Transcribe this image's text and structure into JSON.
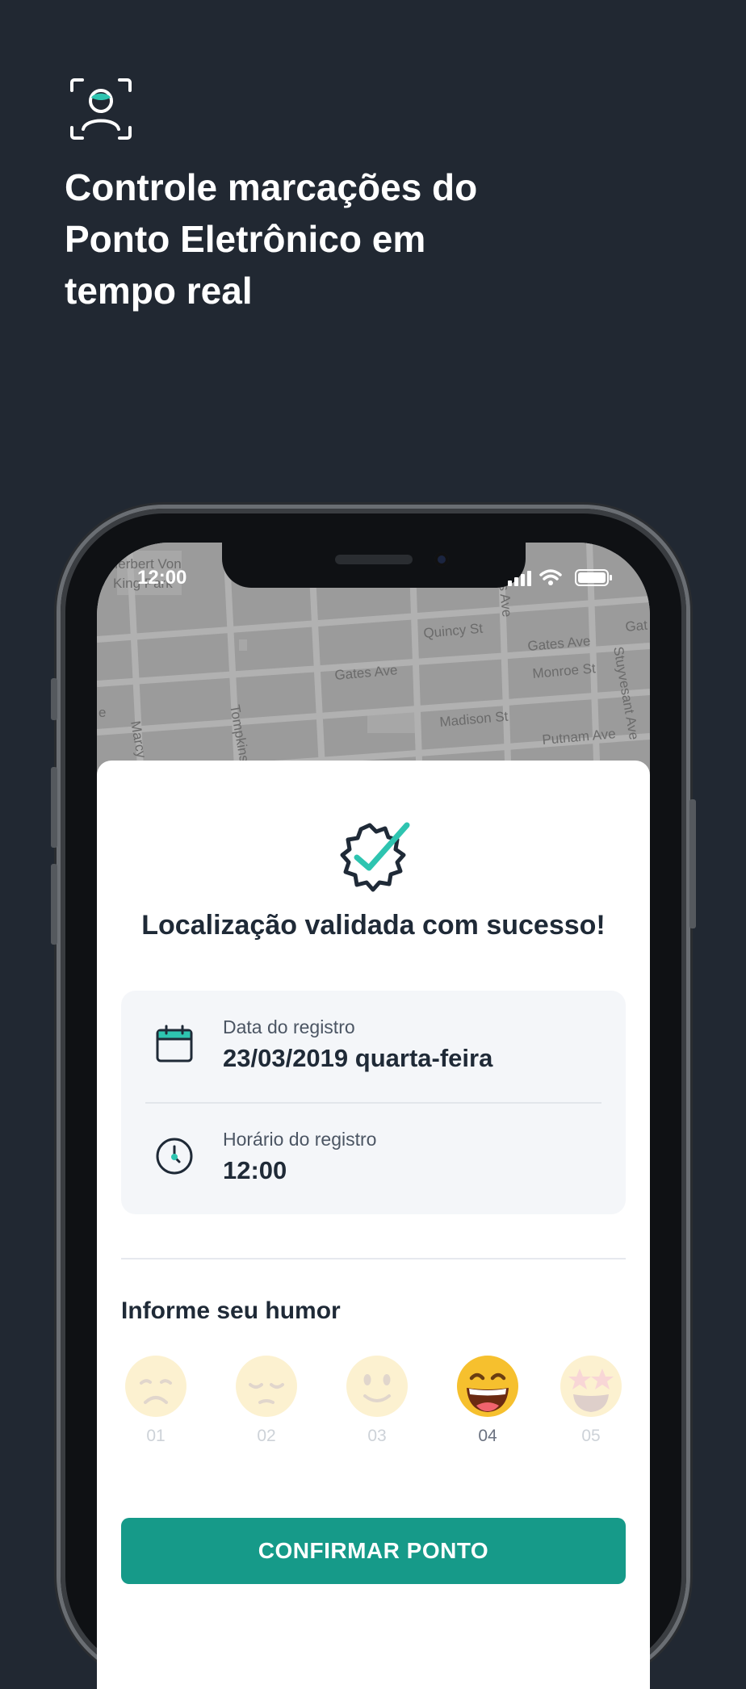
{
  "hero": {
    "icon": "face-scan-icon",
    "headline_lines": [
      "Controle marcações do",
      "Ponto Eletrônico em",
      "tempo real"
    ]
  },
  "status_bar": {
    "time": "12:00"
  },
  "map": {
    "streets": [
      "Herbert Von",
      "King Park",
      "Quincy St",
      "Gates Ave",
      "Gates Ave",
      "Monroe St",
      "Madison St",
      "Putnam Ave",
      "Tompkins",
      "Marcy",
      "Stuyvesant Ave",
      "is Ave",
      "Gat",
      "e"
    ]
  },
  "sheet": {
    "success_icon": "badge-check-icon",
    "success_title": "Localização validada com sucesso!",
    "date_label": "Data do registro",
    "date_value": "23/03/2019 quarta-feira",
    "time_label": "Horário do registro",
    "time_value": "12:00",
    "mood_title": "Informe seu humor",
    "moods": [
      {
        "number": "01",
        "icon": "sad-face-icon",
        "selected": false
      },
      {
        "number": "02",
        "icon": "pensive-face-icon",
        "selected": false
      },
      {
        "number": "03",
        "icon": "slight-smile-face-icon",
        "selected": false
      },
      {
        "number": "04",
        "icon": "grinning-face-icon",
        "selected": true
      },
      {
        "number": "05",
        "icon": "star-struck-face-icon",
        "selected": false
      }
    ],
    "confirm_label": "CONFIRMAR PONTO"
  },
  "colors": {
    "background": "#212832",
    "accent": "#169a89",
    "sheet": "#ffffff"
  }
}
